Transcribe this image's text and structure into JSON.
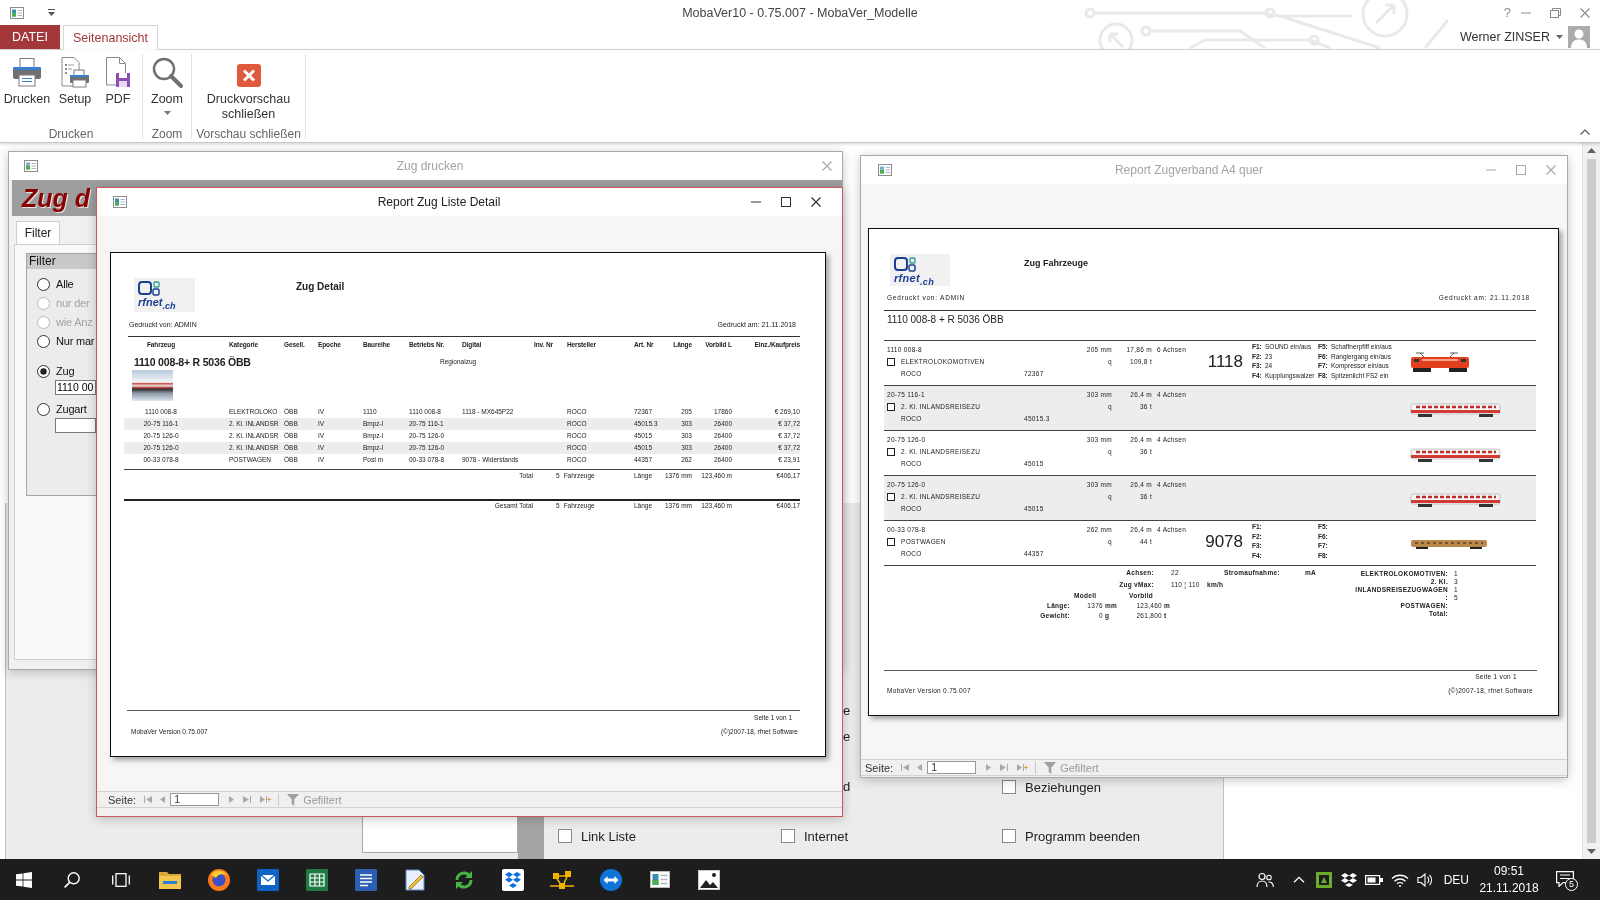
{
  "app": {
    "title": "MobaVer10 - 0.75.007 - MobaVer_Modelle",
    "help": "?",
    "user": "Werner ZINSER"
  },
  "ribbon": {
    "tabs": [
      {
        "label": "DATEI",
        "kind": "file",
        "selected": false
      },
      {
        "label": "Seitenansicht",
        "kind": "tab",
        "selected": true
      }
    ],
    "groups": [
      {
        "label": "Drucken",
        "buttons": [
          {
            "label": "Drucken"
          },
          {
            "label": "Setup"
          },
          {
            "label": "PDF"
          }
        ]
      },
      {
        "label": "Zoom",
        "buttons": [
          {
            "label": "Zoom",
            "dropdown": true
          }
        ]
      },
      {
        "label": "Vorschau schließen",
        "buttons": [
          {
            "label": "Druckvorschau schließen"
          }
        ]
      }
    ]
  },
  "main_form": {
    "label_fragments": [
      "e",
      "e",
      "d"
    ],
    "checkboxes": [
      {
        "label": "Beziehungen",
        "checked": false
      },
      {
        "label": "Link Liste",
        "checked": false
      },
      {
        "label": "Internet",
        "checked": false
      },
      {
        "label": "Programm beenden",
        "checked": false
      }
    ]
  },
  "print_dialog": {
    "title": "Zug drucken",
    "active": false,
    "heading": "Zug d",
    "tabs": [
      {
        "label": "Filter",
        "selected": true
      }
    ],
    "filter": {
      "title": "Filter",
      "options": [
        {
          "kind": "radio",
          "label": "Alle",
          "selected": false,
          "disabled": false
        },
        {
          "kind": "radio",
          "label": "nur der",
          "selected": false,
          "disabled": true
        },
        {
          "kind": "radio",
          "label": "wie Anz",
          "selected": false,
          "disabled": true
        },
        {
          "kind": "radio",
          "label": "Nur mar",
          "selected": false,
          "disabled": false
        },
        {
          "kind": "radio_field",
          "label": "Zug",
          "selected": true,
          "disabled": false,
          "value": "1110 00"
        },
        {
          "kind": "radio_field",
          "label": "Zugart",
          "selected": false,
          "disabled": false
        }
      ]
    }
  },
  "vehicle_report": {
    "title": "Report Zugverband A4 quer",
    "active": false,
    "page": {
      "logo": "rfnet$_{.ch}$",
      "heading": "Zug Fahrzeuge",
      "printed_by": "Gedruckt von: ADMIN",
      "printed_on": "Gedruckt am: 21.11.2018",
      "train": "1110 008-8 + R 5036 ÖBB",
      "vehicles": [
        {
          "kind": "locomotive",
          "number": "1110 008-8",
          "checked": false,
          "category": "ELEKTROLOKOMOTIVEN",
          "maker": "ROCO",
          "article": "72367",
          "model_length": "205 mm",
          "real_length": "17,86 m",
          "axles": "6 Achsen",
          "weight_label": "q",
          "weight": "109,8 t",
          "address": "1118",
          "functions": [
            {
              "key": "F1:",
              "label": "SOUND ein/aus"
            },
            {
              "key": "F2:",
              "label": "23"
            },
            {
              "key": "F3:",
              "label": "24"
            },
            {
              "key": "F4:",
              "label": "Kupplungswalzer"
            },
            {
              "key": "F5:",
              "label": "Schaffnerpfiff ein/aus"
            },
            {
              "key": "F6:",
              "label": "Rangiergang ein/aus"
            },
            {
              "key": "F7:",
              "label": "Kompressor ein/aus"
            },
            {
              "key": "F8:",
              "label": "Spitzenlicht FS2 ein"
            }
          ]
        },
        {
          "kind": "coach",
          "number": "20-75 116-1",
          "checked": false,
          "category": "2. Kl. INLANDSREISEZU",
          "maker": "ROCO",
          "article": "45015.3",
          "model_length": "303 mm",
          "real_length": "26,4 m",
          "axles": "4 Achsen",
          "weight_label": "q",
          "weight": "36 t"
        },
        {
          "kind": "coach",
          "number": "20-75 126-0",
          "checked": false,
          "category": "2. Kl. INLANDSREISEZU",
          "maker": "ROCO",
          "article": "45015",
          "model_length": "303 mm",
          "real_length": "26,4 m",
          "axles": "4 Achsen",
          "weight_label": "q",
          "weight": "36 t"
        },
        {
          "kind": "coach",
          "number": "20-75 126-0",
          "checked": false,
          "category": "2. Kl. INLANDSREISEZU",
          "maker": "ROCO",
          "article": "45015",
          "model_length": "303 mm",
          "real_length": "26,4 m",
          "axles": "4 Achsen",
          "weight_label": "q",
          "weight": "36 t"
        },
        {
          "kind": "mail_car",
          "number": "00-33 078-8",
          "checked": false,
          "category": "POSTWAGEN",
          "maker": "ROCO",
          "article": "44357",
          "model_length": "262 mm",
          "real_length": "26,4 m",
          "axles": "4 Achsen",
          "weight_label": "q",
          "weight": "44 t",
          "address": "9078",
          "functions": [
            {
              "key": "F1:"
            },
            {
              "key": "F2:"
            },
            {
              "key": "F3:"
            },
            {
              "key": "F4:"
            },
            {
              "key": "F5:"
            },
            {
              "key": "F6:"
            },
            {
              "key": "F7:"
            },
            {
              "key": "F8:"
            }
          ]
        }
      ],
      "summary": {
        "axles_label": "Achsen:",
        "axles": "22",
        "current_label": "Stromaufnahme:",
        "current_unit": "mA",
        "vmax_label": "Zug vMax:",
        "vmax": "110 ¦ 110",
        "vmax_unit": "km/h",
        "model_label": "Modell",
        "prototype_label": "Vorbild",
        "length_label": "Länge:",
        "model_length": "1376",
        "model_length_unit": "mm",
        "real_length": "123,460",
        "real_length_unit": "m",
        "weight_label": "Gewicht:",
        "model_weight": "0",
        "model_weight_unit": "g",
        "real_weight": "261,800",
        "real_weight_unit": "t"
      },
      "counts": [
        {
          "label": "ELEKTROLOKOMOTIVEN:",
          "value": "1"
        },
        {
          "label": "2. Kl.",
          "value": "3"
        },
        {
          "label": "INLANDSREISEZUGWAGEN",
          "value": "1"
        },
        {
          "label": ":",
          "value": "5"
        },
        {
          "label": "POSTWAGEN:"
        },
        {
          "label": "Total:"
        }
      ],
      "page_number": "Seite 1 von 1",
      "version": "MobaVer Version 0.75.007",
      "copyright": "(©)2007-18, rfnet Software"
    },
    "navigation": {
      "label": "Seite:",
      "page": "1",
      "filter": "Gefiltert"
    }
  },
  "detail_report": {
    "title": "Report Zug Liste Detail",
    "active": true,
    "page": {
      "logo": "rfnet$_{.ch}$",
      "heading": "Zug Detail",
      "printed_by": "Gedruckt von: ADMIN",
      "printed_on": "Gedruckt am: 21.11.2018",
      "columns": [
        "Fahrzeug",
        "Kategorie",
        "Gesell.",
        "Epoche",
        "Baureihe",
        "Betriebs Nr.",
        "Digital",
        "Inv. Nr",
        "Hersteller",
        "Art. Nr",
        "Länge",
        "Vorbild L",
        "Einz./Kaufpreis"
      ],
      "train": {
        "name": "1110 008-8+ R 5036 ÖBB",
        "category": "Regionalzug"
      },
      "rows": [
        {
          "vehicle": "1110 008-8",
          "category": "ELEKTROLOKO",
          "company": "ÖBB",
          "epoch": "IV",
          "series": "1110",
          "number": "1110 008-8",
          "digital": "1118 - MX645P22",
          "maker": "ROCO",
          "article": "72367",
          "length": "205",
          "real_length": "17860",
          "price": "€ 269,10"
        },
        {
          "vehicle": "20-75 116-1",
          "category": "2. Kl. INLANDSR",
          "company": "ÖBB",
          "epoch": "IV",
          "series": "Bmpz-l",
          "number": "20-75 116-1",
          "maker": "ROCO",
          "article": "45015.3",
          "length": "303",
          "real_length": "26400",
          "price": "€ 37,72"
        },
        {
          "vehicle": "20-75 126-0",
          "category": "2. Kl. INLANDSR",
          "company": "ÖBB",
          "epoch": "IV",
          "series": "Bmpz-l",
          "number": "20-75 126-0",
          "maker": "ROCO",
          "article": "45015",
          "length": "303",
          "real_length": "26400",
          "price": "€ 37,72"
        },
        {
          "vehicle": "20-75 126-0",
          "category": "2. Kl. INLANDSR",
          "company": "ÖBB",
          "epoch": "IV",
          "series": "Bmpz-l",
          "number": "20-75 126-0",
          "maker": "ROCO",
          "article": "45015",
          "length": "303",
          "real_length": "26400",
          "price": "€ 37,72"
        },
        {
          "vehicle": "00-33 078-8",
          "category": "POSTWAGEN",
          "company": "ÖBB",
          "epoch": "IV",
          "series": "Post m",
          "number": "00-33 078-8",
          "digital": "9078 - Widerstands",
          "maker": "ROCO",
          "article": "44357",
          "length": "262",
          "real_length": "26400",
          "price": "€ 23,91"
        }
      ],
      "total": {
        "label": "Total",
        "count": "5",
        "unit": "Fahrzeuge",
        "length_label": "Länge",
        "model_length": "1376 mm",
        "real_length": "123,460 m",
        "price": "€406,17"
      },
      "grand_total": {
        "label": "Gesamt Total",
        "count": "5",
        "unit": "Fahrzeuge",
        "length_label": "Länge",
        "model_length": "1376 mm",
        "real_length": "123,460 m",
        "price": "€406,17"
      },
      "page_number": "Seite 1 von 1",
      "version": "MobaVer Version 0.75.007",
      "copyright": "(©)2007-18, rfnet Software"
    },
    "navigation": {
      "label": "Seite:",
      "page": "1",
      "filter": "Gefiltert"
    }
  },
  "taskbar": {
    "language": "DEU",
    "time": "09:51",
    "date": "21.11.2018",
    "notifications": "5"
  }
}
